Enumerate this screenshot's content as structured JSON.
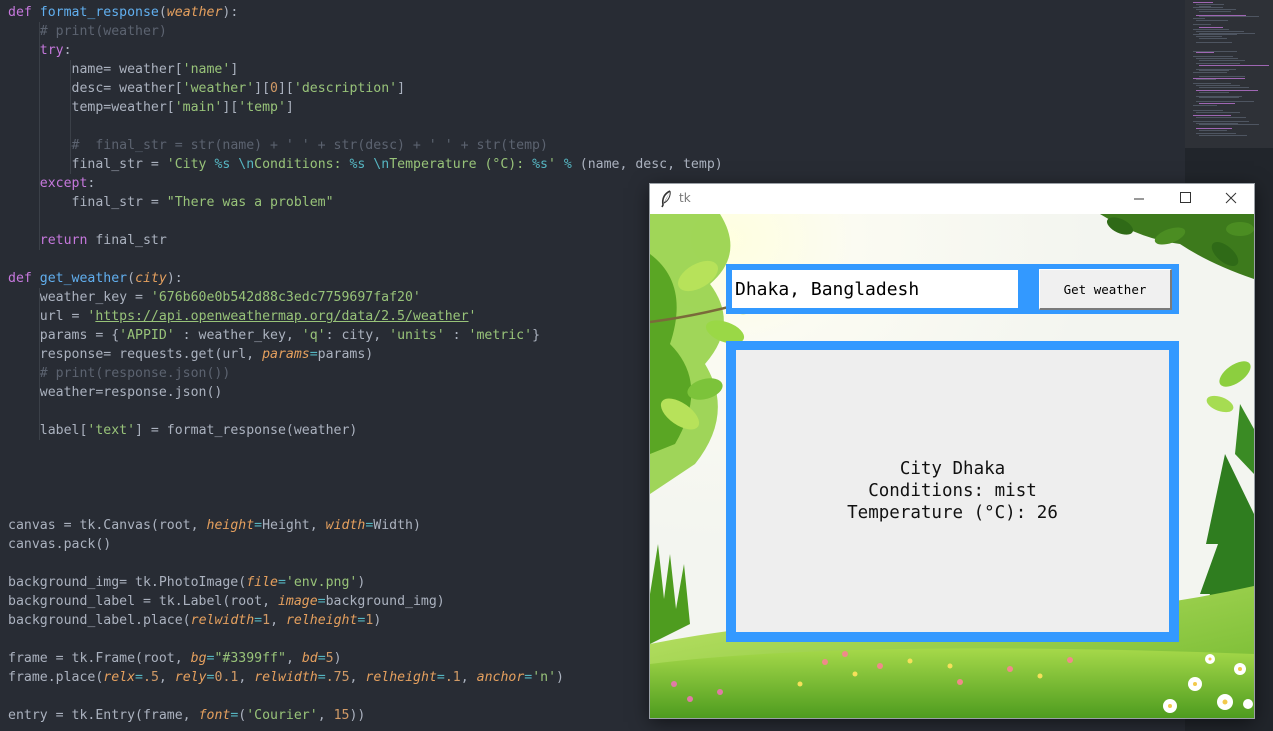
{
  "editor": {
    "lines": [
      [
        [
          "kw",
          "def "
        ],
        [
          "fn",
          "format_response"
        ],
        [
          "",
          "("
        ],
        [
          "pm",
          "weather"
        ],
        [
          "",
          "):"
        ]
      ],
      [
        [
          "",
          "    "
        ],
        [
          "cm",
          "# print(weather)"
        ]
      ],
      [
        [
          "",
          "    "
        ],
        [
          "kw",
          "try"
        ],
        [
          "",
          ":"
        ]
      ],
      [
        [
          "",
          "        name= weather["
        ],
        [
          "st",
          "'name'"
        ],
        [
          "",
          "]"
        ]
      ],
      [
        [
          "",
          "        desc= weather["
        ],
        [
          "st",
          "'weather'"
        ],
        [
          "",
          "]["
        ],
        [
          "nu",
          "0"
        ],
        [
          "",
          "]["
        ],
        [
          "st",
          "'description'"
        ],
        [
          "",
          "]"
        ]
      ],
      [
        [
          "",
          "        temp=weather["
        ],
        [
          "st",
          "'main'"
        ],
        [
          "",
          "]["
        ],
        [
          "st",
          "'temp'"
        ],
        [
          "",
          "]"
        ]
      ],
      [
        [
          "",
          ""
        ]
      ],
      [
        [
          "",
          "        "
        ],
        [
          "cm",
          "#  final_str = str(name) + ' ' + str(desc) + ' ' + str(temp)"
        ]
      ],
      [
        [
          "",
          "        final_str = "
        ],
        [
          "st",
          "'City "
        ],
        [
          "fmt",
          "%s"
        ],
        [
          "st",
          " "
        ],
        [
          "fmt",
          "\\n"
        ],
        [
          "st",
          "Conditions: "
        ],
        [
          "fmt",
          "%s"
        ],
        [
          "st",
          " "
        ],
        [
          "fmt",
          "\\n"
        ],
        [
          "st",
          "Temperature (°C): "
        ],
        [
          "fmt",
          "%s"
        ],
        [
          "st",
          "'"
        ],
        [
          "",
          ""
        ],
        [
          "op",
          " % "
        ],
        [
          "",
          "(name, desc, temp)"
        ]
      ],
      [
        [
          "",
          "    "
        ],
        [
          "kw",
          "except"
        ],
        [
          "",
          ":"
        ]
      ],
      [
        [
          "",
          "        final_str = "
        ],
        [
          "st",
          "\"There was a problem\""
        ]
      ],
      [
        [
          "",
          ""
        ]
      ],
      [
        [
          "",
          "    "
        ],
        [
          "kw",
          "return"
        ],
        [
          "",
          " final_str"
        ]
      ],
      [
        [
          "",
          ""
        ]
      ],
      [
        [
          "kw",
          "def "
        ],
        [
          "fn",
          "get_weather"
        ],
        [
          "",
          "("
        ],
        [
          "pm",
          "city"
        ],
        [
          "",
          "):"
        ]
      ],
      [
        [
          "",
          "    weather_key = "
        ],
        [
          "st",
          "'676b60e0b542d88c3edc7759697faf20'"
        ]
      ],
      [
        [
          "",
          "    url = "
        ],
        [
          "st",
          "'"
        ],
        [
          "st url",
          "https://api.openweathermap.org/data/2.5/weather"
        ],
        [
          "st",
          "'"
        ]
      ],
      [
        [
          "",
          "    params = {"
        ],
        [
          "st",
          "'APPID'"
        ],
        [
          "",
          " : weather_key, "
        ],
        [
          "st",
          "'q'"
        ],
        [
          "",
          ": city, "
        ],
        [
          "st",
          "'units'"
        ],
        [
          "",
          " : "
        ],
        [
          "st",
          "'metric'"
        ],
        [
          "",
          "}"
        ]
      ],
      [
        [
          "",
          "    response= requests.get(url, "
        ],
        [
          "pm",
          "params"
        ],
        [
          "op",
          "="
        ],
        [
          "",
          "params)"
        ]
      ],
      [
        [
          "",
          "    "
        ],
        [
          "cm",
          "# print(response.json())"
        ]
      ],
      [
        [
          "",
          "    weather=response.json()"
        ]
      ],
      [
        [
          "",
          ""
        ]
      ],
      [
        [
          "",
          "    label["
        ],
        [
          "st",
          "'text'"
        ],
        [
          "",
          "] = format_response(weather)"
        ]
      ],
      [
        [
          "",
          ""
        ]
      ],
      [
        [
          "",
          ""
        ]
      ],
      [
        [
          "",
          ""
        ]
      ],
      [
        [
          "",
          ""
        ]
      ],
      [
        [
          "",
          "canvas = tk.Canvas(root, "
        ],
        [
          "pm",
          "height"
        ],
        [
          "op",
          "="
        ],
        [
          "",
          "Height, "
        ],
        [
          "pm",
          "width"
        ],
        [
          "op",
          "="
        ],
        [
          "",
          "Width)"
        ]
      ],
      [
        [
          "",
          "canvas.pack()"
        ]
      ],
      [
        [
          "",
          ""
        ]
      ],
      [
        [
          "",
          "background_img= tk.PhotoImage("
        ],
        [
          "pm",
          "file"
        ],
        [
          "op",
          "="
        ],
        [
          "st",
          "'env.png'"
        ],
        [
          "",
          ")"
        ]
      ],
      [
        [
          "",
          "background_label = tk.Label(root, "
        ],
        [
          "pm",
          "image"
        ],
        [
          "op",
          "="
        ],
        [
          "",
          "background_img)"
        ]
      ],
      [
        [
          "",
          "background_label.place("
        ],
        [
          "pm",
          "relwidth"
        ],
        [
          "op",
          "="
        ],
        [
          "nu",
          "1"
        ],
        [
          "",
          ", "
        ],
        [
          "pm",
          "relheight"
        ],
        [
          "op",
          "="
        ],
        [
          "nu",
          "1"
        ],
        [
          "",
          ")"
        ]
      ],
      [
        [
          "",
          ""
        ]
      ],
      [
        [
          "",
          "frame = tk.Frame(root, "
        ],
        [
          "pm",
          "bg"
        ],
        [
          "op",
          "="
        ],
        [
          "st",
          "\"#3399ff\""
        ],
        [
          "",
          ", "
        ],
        [
          "pm",
          "bd"
        ],
        [
          "op",
          "="
        ],
        [
          "nu",
          "5"
        ],
        [
          "",
          ")"
        ]
      ],
      [
        [
          "",
          "frame.place("
        ],
        [
          "pm",
          "relx"
        ],
        [
          "op",
          "="
        ],
        [
          "nu",
          ".5"
        ],
        [
          "",
          ", "
        ],
        [
          "pm",
          "rely"
        ],
        [
          "op",
          "="
        ],
        [
          "nu",
          "0.1"
        ],
        [
          "",
          ", "
        ],
        [
          "pm",
          "relwidth"
        ],
        [
          "op",
          "="
        ],
        [
          "nu",
          ".75"
        ],
        [
          "",
          ", "
        ],
        [
          "pm",
          "relheight"
        ],
        [
          "op",
          "="
        ],
        [
          "nu",
          ".1"
        ],
        [
          "",
          ", "
        ],
        [
          "pm",
          "anchor"
        ],
        [
          "op",
          "="
        ],
        [
          "st",
          "'n'"
        ],
        [
          "",
          ")"
        ]
      ],
      [
        [
          "",
          ""
        ]
      ],
      [
        [
          "",
          "entry = tk.Entry(frame, "
        ],
        [
          "pm",
          "font"
        ],
        [
          "op",
          "="
        ],
        [
          "",
          "("
        ],
        [
          "st",
          "'Courier'"
        ],
        [
          "",
          ", "
        ],
        [
          "nu",
          "15"
        ],
        [
          "",
          "))"
        ]
      ]
    ]
  },
  "tk_window": {
    "title": "tk",
    "entry_value": "Dhaka, Bangladesh",
    "button_label": "Get weather",
    "result_lines": [
      "City Dhaka",
      "Conditions: mist",
      "Temperature (°C): 26"
    ]
  },
  "colors": {
    "frame_blue": "#3399ff",
    "panel_bg": "#eeeeee",
    "editor_bg": "#282c34"
  },
  "icons": [
    "feather-icon",
    "minimize-icon",
    "maximize-icon",
    "close-icon"
  ]
}
